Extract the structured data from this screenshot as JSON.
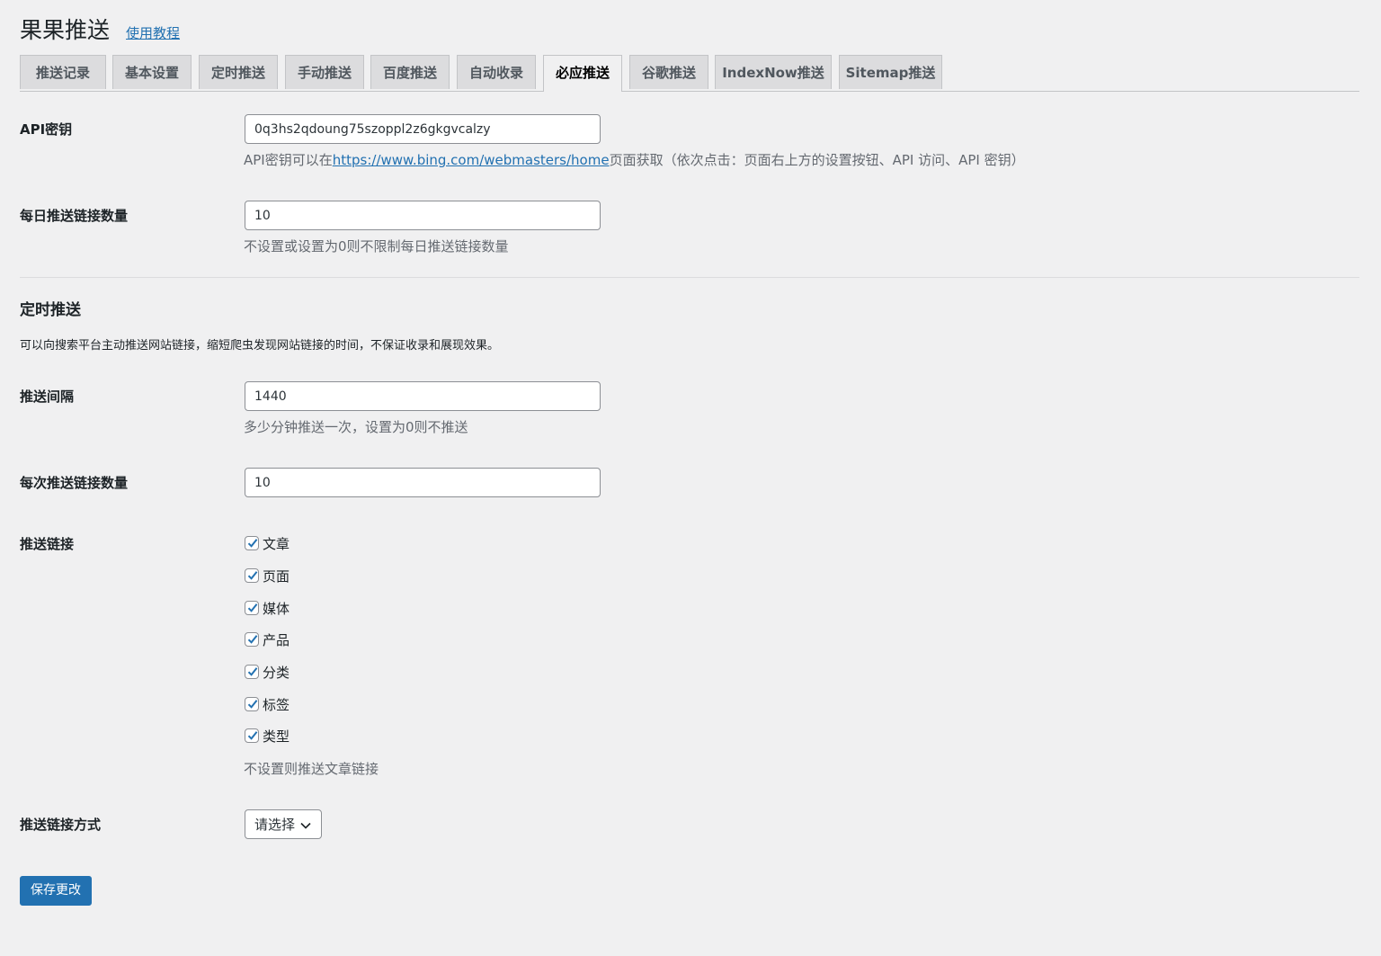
{
  "header": {
    "title": "果果推送",
    "tutorial_link": "使用教程"
  },
  "tabs": [
    {
      "label": "推送记录",
      "active": false
    },
    {
      "label": "基本设置",
      "active": false
    },
    {
      "label": "定时推送",
      "active": false
    },
    {
      "label": "手动推送",
      "active": false
    },
    {
      "label": "百度推送",
      "active": false
    },
    {
      "label": "自动收录",
      "active": false
    },
    {
      "label": "必应推送",
      "active": true
    },
    {
      "label": "谷歌推送",
      "active": false
    },
    {
      "label": "IndexNow推送",
      "active": false
    },
    {
      "label": "Sitemap推送",
      "active": false
    }
  ],
  "api_key": {
    "label": "API密钥",
    "value": "0q3hs2qdoung75szoppl2z6gkgvcalzy",
    "desc_prefix": "API密钥可以在",
    "desc_link": "https://www.bing.com/webmasters/home",
    "desc_suffix": "页面获取（依次点击：页面右上方的设置按钮、API 访问、API 密钥）"
  },
  "daily_limit": {
    "label": "每日推送链接数量",
    "value": "10",
    "desc": "不设置或设置为0则不限制每日推送链接数量"
  },
  "schedule_section": {
    "title": "定时推送",
    "desc": "可以向搜索平台主动推送网站链接，缩短爬虫发现网站链接的时间，不保证收录和展现效果。"
  },
  "interval": {
    "label": "推送间隔",
    "value": "1440",
    "desc": "多少分钟推送一次，设置为0则不推送"
  },
  "per_push": {
    "label": "每次推送链接数量",
    "value": "10"
  },
  "link_types": {
    "label": "推送链接",
    "options": [
      {
        "label": "文章",
        "checked": true
      },
      {
        "label": "页面",
        "checked": true
      },
      {
        "label": "媒体",
        "checked": true
      },
      {
        "label": "产品",
        "checked": true
      },
      {
        "label": "分类",
        "checked": true
      },
      {
        "label": "标签",
        "checked": true
      },
      {
        "label": "类型",
        "checked": true
      }
    ],
    "desc": "不设置则推送文章链接"
  },
  "push_method": {
    "label": "推送链接方式",
    "selected": "请选择"
  },
  "save_button": "保存更改",
  "colors": {
    "background": "#f0f0f1",
    "primary_button": "#2271b1",
    "link": "#2271b1",
    "inactive_tab": "#dcdcde"
  }
}
